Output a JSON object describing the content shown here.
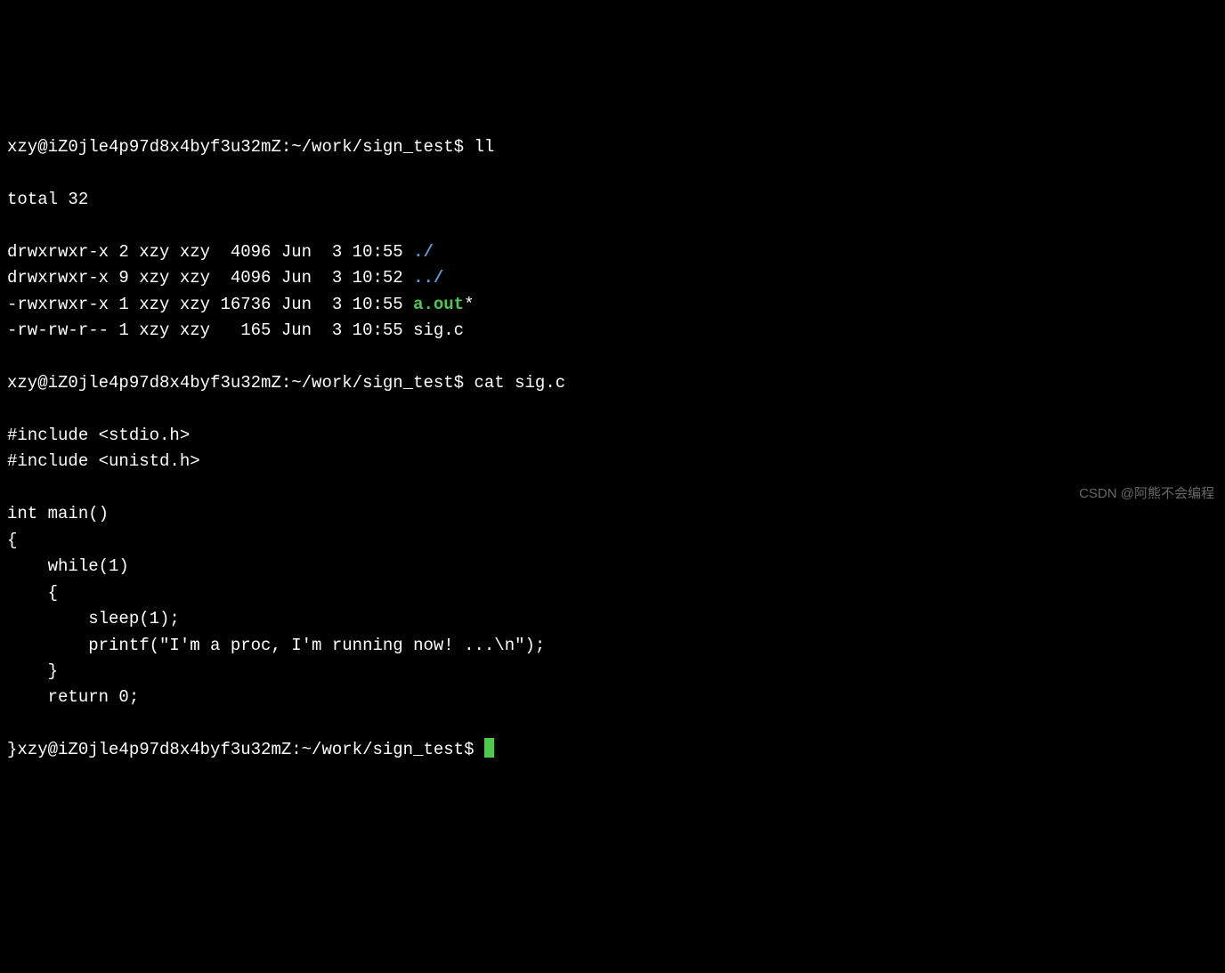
{
  "prompt1": "xzy@iZ0jle4p97d8x4byf3u32mZ:~/work/sign_test$ ",
  "cmd1": "ll",
  "ll_total": "total 32",
  "ll_rows": [
    {
      "meta": "drwxrwxr-x 2 xzy xzy  4096 Jun  3 10:55 ",
      "name": "./",
      "cls": "dir",
      "suffix": ""
    },
    {
      "meta": "drwxrwxr-x 9 xzy xzy  4096 Jun  3 10:52 ",
      "name": "../",
      "cls": "dir",
      "suffix": ""
    },
    {
      "meta": "-rwxrwxr-x 1 xzy xzy 16736 Jun  3 10:55 ",
      "name": "a.out",
      "cls": "exe",
      "suffix": "*"
    },
    {
      "meta": "-rw-rw-r-- 1 xzy xzy   165 Jun  3 10:55 ",
      "name": "sig.c",
      "cls": "",
      "suffix": ""
    }
  ],
  "prompt2": "xzy@iZ0jle4p97d8x4byf3u32mZ:~/work/sign_test$ ",
  "cmd2": "cat sig.c",
  "src": [
    "#include <stdio.h>",
    "#include <unistd.h>",
    "",
    "int main()",
    "{",
    "    while(1)",
    "    {",
    "        sleep(1);",
    "        printf(\"I'm a proc, I'm running now! ...\\n\");",
    "    }",
    "    return 0;",
    "}"
  ],
  "lastline_prefix": "}",
  "prompt3": "xzy@iZ0jle4p97d8x4byf3u32mZ:~/work/sign_test$ ",
  "watermark": "CSDN @阿熊不会编程"
}
